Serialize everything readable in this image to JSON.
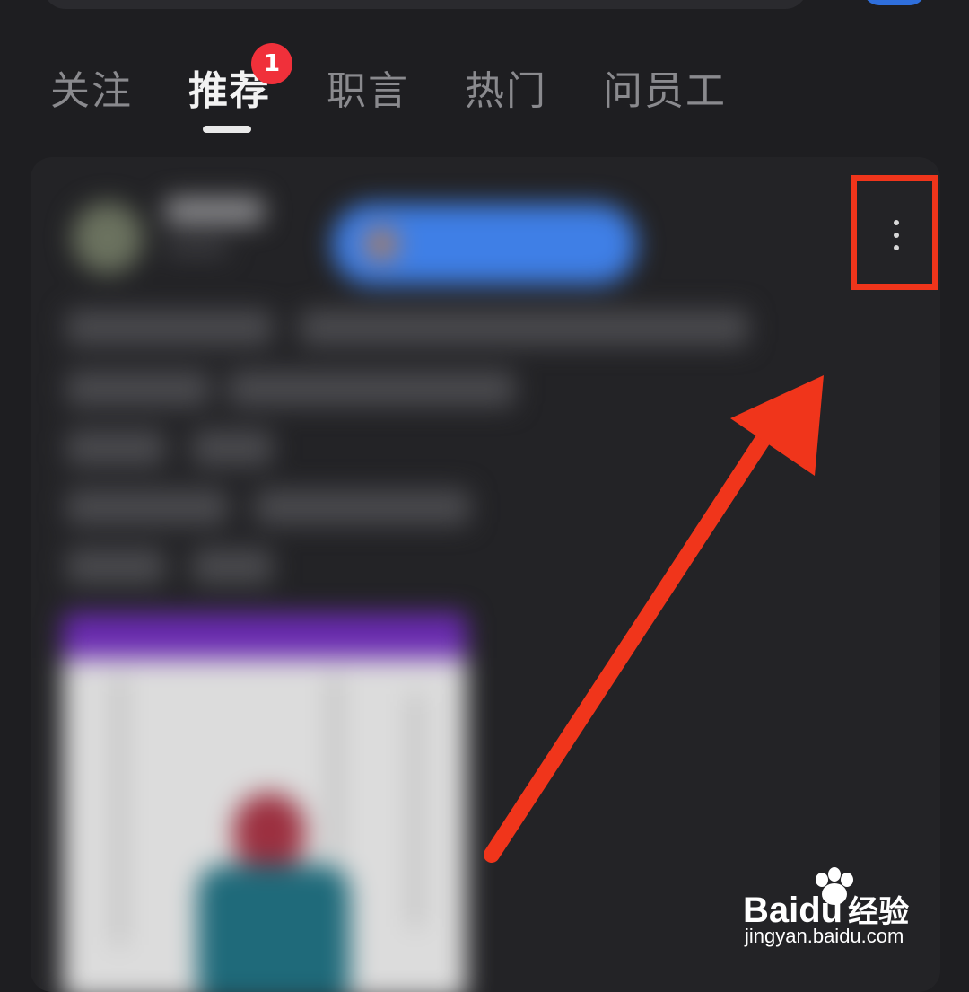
{
  "tabs": [
    {
      "label": "关注",
      "active": false
    },
    {
      "label": "推荐",
      "active": true,
      "badge": "1"
    },
    {
      "label": "职言",
      "active": false
    },
    {
      "label": "热门",
      "active": false
    },
    {
      "label": "问员工",
      "active": false
    }
  ],
  "post": {
    "more_icon": "more-vertical-icon",
    "content_blurred": true
  },
  "annotation": {
    "highlight_color": "#f0351b",
    "arrow_color": "#f0351b",
    "target": "more-options-button"
  },
  "watermark": {
    "logo_prefix": "Bai",
    "logo_du": "du",
    "logo_suffix": "经验",
    "url": "jingyan.baidu.com"
  },
  "colors": {
    "background": "#1e1e21",
    "badge": "#f0303a",
    "active_tab": "#f2f2f2",
    "inactive_tab": "#8a8a8e"
  }
}
